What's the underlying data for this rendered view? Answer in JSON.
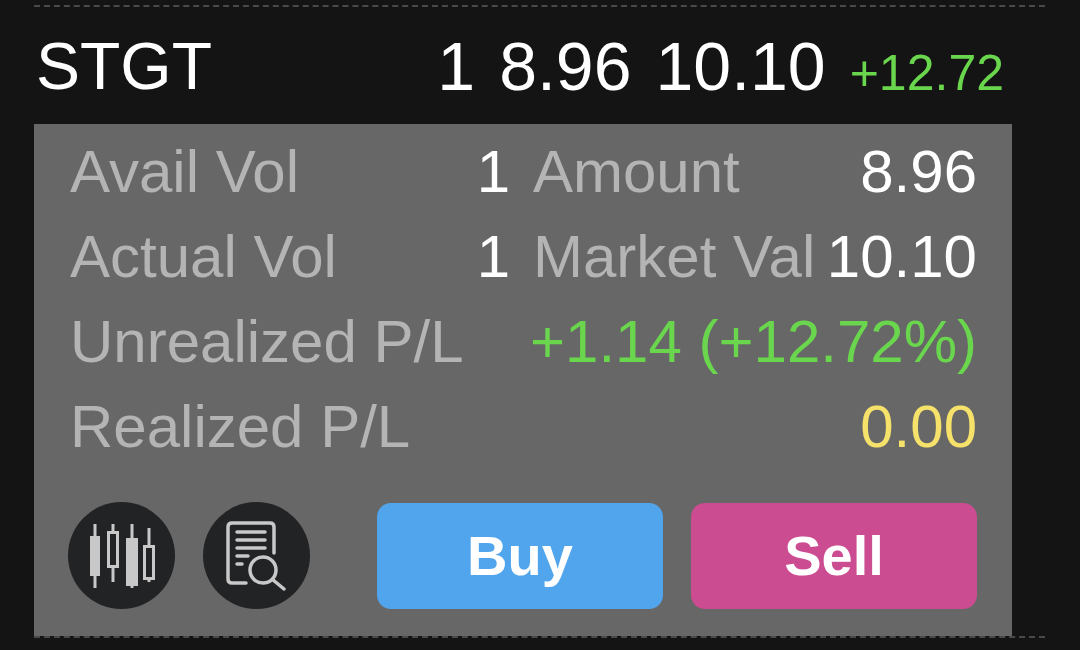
{
  "position": {
    "symbol": "STGT",
    "quantity": "1",
    "cost": "8.96",
    "price": "10.10",
    "change": "+12.72",
    "color": "#6ad64e"
  },
  "details": [
    {
      "kind": "pair",
      "label": "Avail Vol",
      "value": "1",
      "label_2": "Amount",
      "value_2": "8.96"
    },
    {
      "kind": "pair",
      "label": "Actual Vol",
      "value": "1",
      "label_2": "Market Val",
      "value_2": "10.10"
    },
    {
      "kind": "single",
      "label": "Unrealized P/L",
      "value": "+1.14 (+12.72%)",
      "color": "#6ad64e"
    },
    {
      "kind": "single",
      "label": "Realized P/L",
      "value": "0.00",
      "color": "#f6e26a"
    }
  ],
  "actions": [
    {
      "label": "Buy",
      "kind": "buy"
    },
    {
      "label": "Sell",
      "kind": "sell"
    }
  ]
}
